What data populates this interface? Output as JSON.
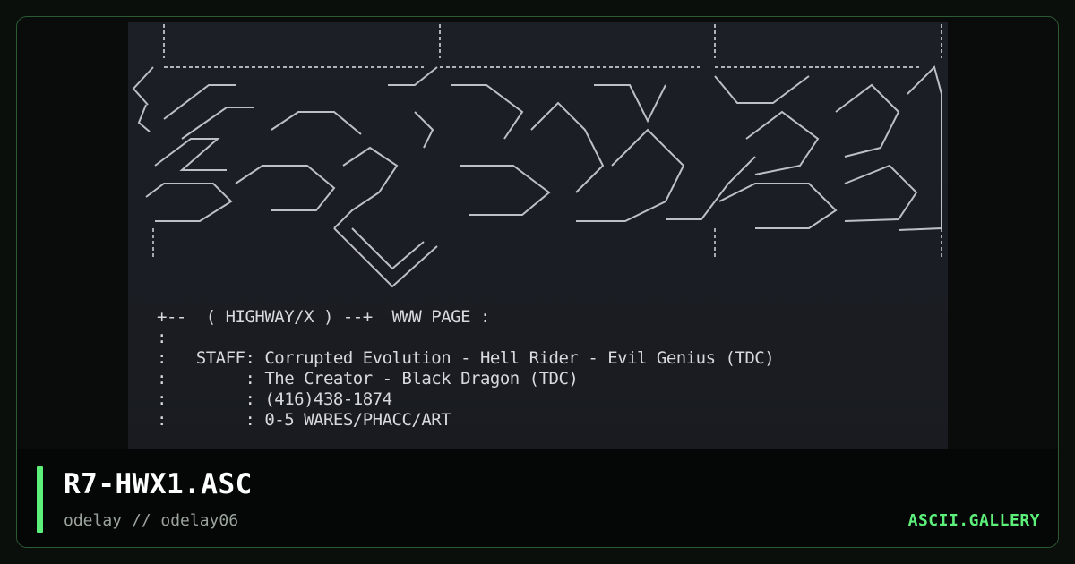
{
  "artwork": {
    "logo_text": "HIGHWAY/X",
    "lines": [
      "+--  ( HIGHWAY/X ) --+  WWW PAGE :",
      ":",
      ":   STAFF: Corrupted Evolution - Hell Rider - Evil Genius (TDC)",
      ":        : The Creator - Black Dragon (TDC)",
      ":        : (416)438-1874",
      ":        : 0-5 WARES/PHACC/ART"
    ]
  },
  "footer": {
    "title": "R7-HWX1.ASC",
    "subtitle": "odelay // odelay06",
    "brand": "ASCII.GALLERY"
  },
  "colors": {
    "accent": "#5cf07a",
    "border": "#2c5a34",
    "art_text": "#d6d9de",
    "art_bg": "#1c1f26"
  }
}
